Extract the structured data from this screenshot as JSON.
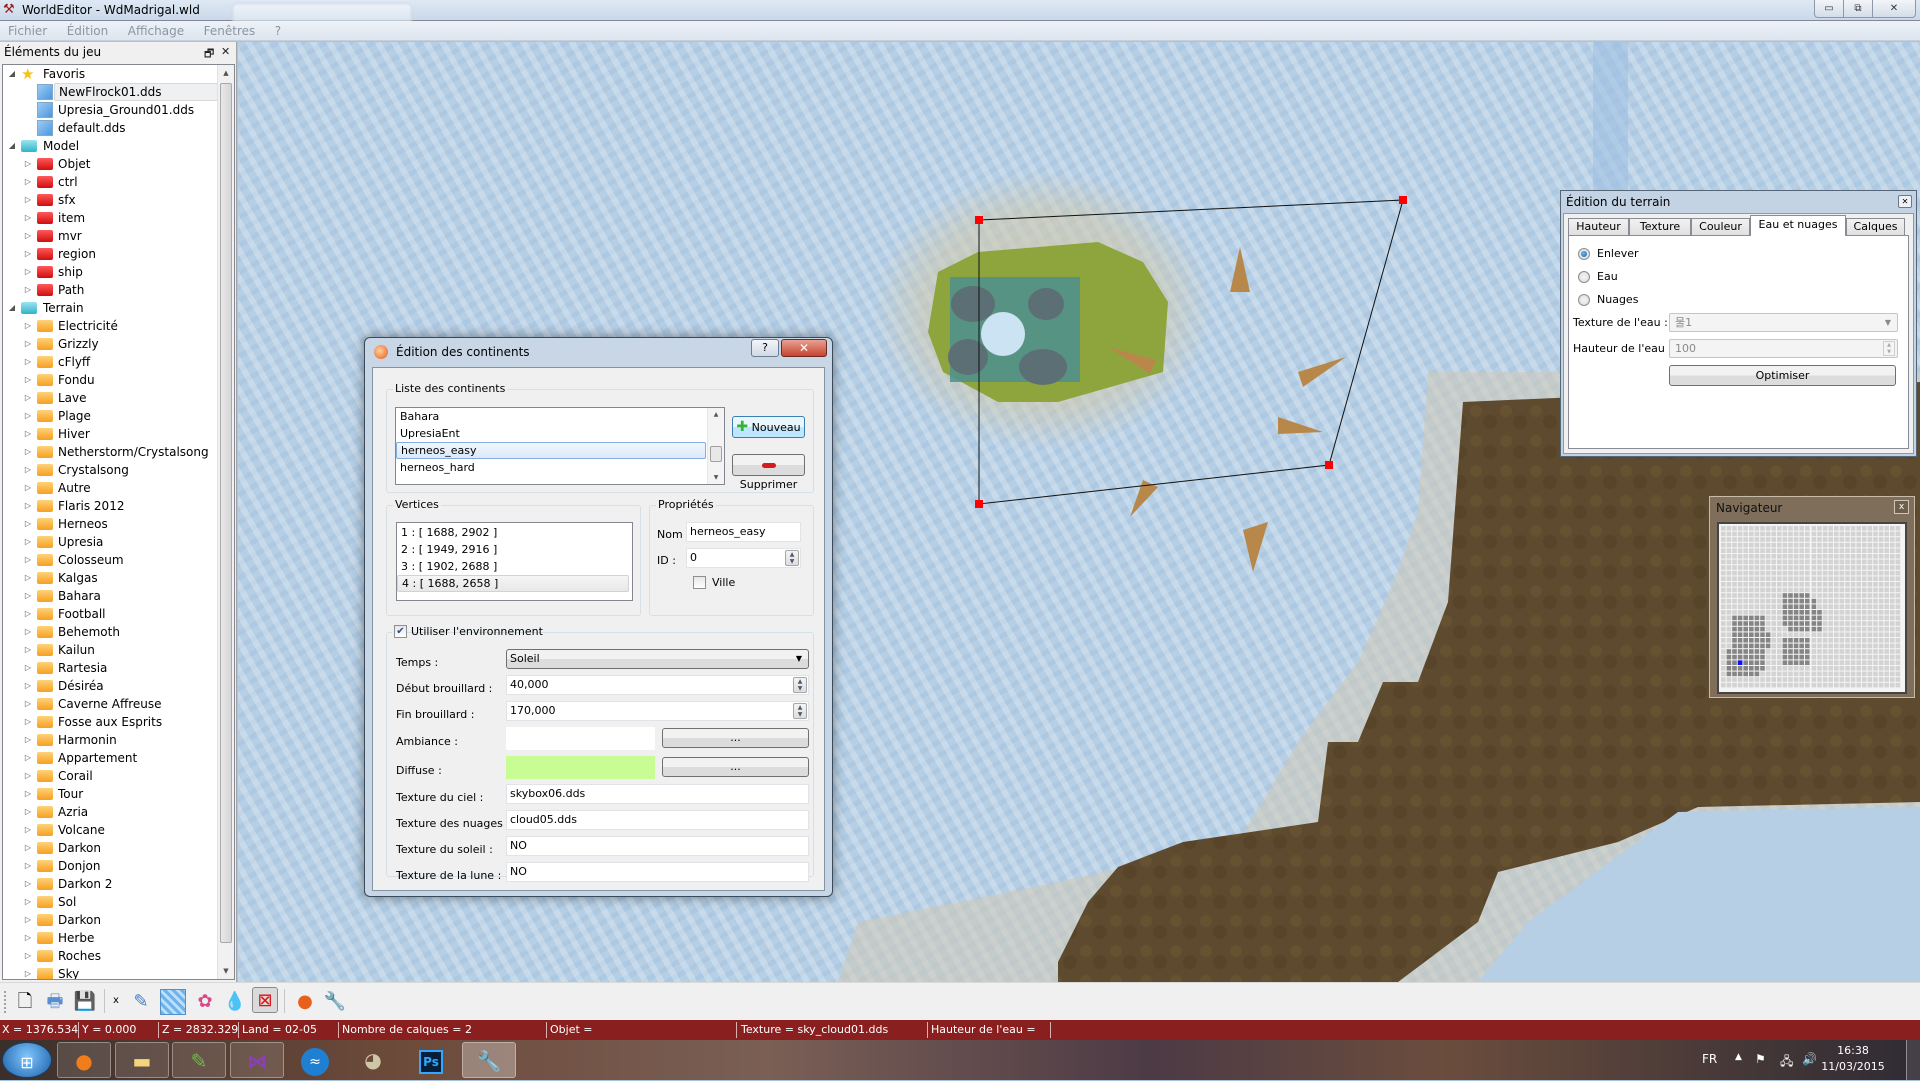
{
  "window": {
    "title": "WorldEditor - WdMadrigal.wld",
    "controls": {
      "minimize": "▭",
      "restore": "⧉",
      "close": "✕"
    }
  },
  "menu": [
    "Fichier",
    "Édition",
    "Affichage",
    "Fenêtres",
    "?"
  ],
  "dock": {
    "title": "Éléments du jeu",
    "float_icon": "🗗",
    "close_icon": "✕",
    "tree": [
      {
        "label": "Favoris",
        "level": 0,
        "icon": "star-icon",
        "expanded": true
      },
      {
        "label": "NewFlrock01.dds",
        "level": 1,
        "icon": "texture-icon",
        "selected": true
      },
      {
        "label": "Upresia_Ground01.dds",
        "level": 1,
        "icon": "texture-icon"
      },
      {
        "label": "default.dds",
        "level": 1,
        "icon": "texture-icon"
      },
      {
        "label": "Model",
        "level": 0,
        "icon": "folder-cyan-icon",
        "expanded": true
      },
      {
        "label": "Objet",
        "level": 1,
        "icon": "folder-red-icon"
      },
      {
        "label": "ctrl",
        "level": 1,
        "icon": "folder-red-icon"
      },
      {
        "label": "sfx",
        "level": 1,
        "icon": "folder-red-icon"
      },
      {
        "label": "item",
        "level": 1,
        "icon": "folder-red-icon"
      },
      {
        "label": "mvr",
        "level": 1,
        "icon": "folder-red-icon"
      },
      {
        "label": "region",
        "level": 1,
        "icon": "folder-red-icon"
      },
      {
        "label": "ship",
        "level": 1,
        "icon": "folder-red-icon"
      },
      {
        "label": "Path",
        "level": 1,
        "icon": "folder-red-icon"
      },
      {
        "label": "Terrain",
        "level": 0,
        "icon": "folder-cyan-icon",
        "expanded": true
      },
      {
        "label": "Electricité",
        "level": 1,
        "icon": "folder-orange-icon"
      },
      {
        "label": "Grizzly",
        "level": 1,
        "icon": "folder-orange-icon"
      },
      {
        "label": "cFlyff",
        "level": 1,
        "icon": "folder-orange-icon"
      },
      {
        "label": "Fondu",
        "level": 1,
        "icon": "folder-orange-icon"
      },
      {
        "label": "Lave",
        "level": 1,
        "icon": "folder-orange-icon"
      },
      {
        "label": "Plage",
        "level": 1,
        "icon": "folder-orange-icon"
      },
      {
        "label": "Hiver",
        "level": 1,
        "icon": "folder-orange-icon"
      },
      {
        "label": "Netherstorm/Crystalsong",
        "level": 1,
        "icon": "folder-orange-icon"
      },
      {
        "label": "Crystalsong",
        "level": 1,
        "icon": "folder-orange-icon"
      },
      {
        "label": "Autre",
        "level": 1,
        "icon": "folder-orange-icon"
      },
      {
        "label": "Flaris 2012",
        "level": 1,
        "icon": "folder-orange-icon"
      },
      {
        "label": "Herneos",
        "level": 1,
        "icon": "folder-orange-icon"
      },
      {
        "label": "Upresia",
        "level": 1,
        "icon": "folder-orange-icon"
      },
      {
        "label": "Colosseum",
        "level": 1,
        "icon": "folder-orange-icon"
      },
      {
        "label": "Kalgas",
        "level": 1,
        "icon": "folder-orange-icon"
      },
      {
        "label": "Bahara",
        "level": 1,
        "icon": "folder-orange-icon"
      },
      {
        "label": "Football",
        "level": 1,
        "icon": "folder-orange-icon"
      },
      {
        "label": "Behemoth",
        "level": 1,
        "icon": "folder-orange-icon"
      },
      {
        "label": "Kailun",
        "level": 1,
        "icon": "folder-orange-icon"
      },
      {
        "label": "Rartesia",
        "level": 1,
        "icon": "folder-orange-icon"
      },
      {
        "label": "Désiréa",
        "level": 1,
        "icon": "folder-orange-icon"
      },
      {
        "label": "Caverne Affreuse",
        "level": 1,
        "icon": "folder-orange-icon"
      },
      {
        "label": "Fosse aux Esprits",
        "level": 1,
        "icon": "folder-orange-icon"
      },
      {
        "label": "Harmonin",
        "level": 1,
        "icon": "folder-orange-icon"
      },
      {
        "label": "Appartement",
        "level": 1,
        "icon": "folder-orange-icon"
      },
      {
        "label": "Corail",
        "level": 1,
        "icon": "folder-orange-icon"
      },
      {
        "label": "Tour",
        "level": 1,
        "icon": "folder-orange-icon"
      },
      {
        "label": "Azria",
        "level": 1,
        "icon": "folder-orange-icon"
      },
      {
        "label": "Volcane",
        "level": 1,
        "icon": "folder-orange-icon"
      },
      {
        "label": "Darkon",
        "level": 1,
        "icon": "folder-orange-icon"
      },
      {
        "label": "Donjon",
        "level": 1,
        "icon": "folder-orange-icon"
      },
      {
        "label": "Darkon 2",
        "level": 1,
        "icon": "folder-orange-icon"
      },
      {
        "label": "Sol",
        "level": 1,
        "icon": "folder-orange-icon"
      },
      {
        "label": "Darkon",
        "level": 1,
        "icon": "folder-orange-icon"
      },
      {
        "label": "Herbe",
        "level": 1,
        "icon": "folder-orange-icon"
      },
      {
        "label": "Roches",
        "level": 1,
        "icon": "folder-orange-icon"
      },
      {
        "label": "Sky",
        "level": 1,
        "icon": "folder-orange-icon"
      }
    ]
  },
  "continents_dialog": {
    "title": "Édition des continents",
    "help": "?",
    "close": "✕",
    "list_group": "Liste des continents",
    "continents": [
      "Bahara",
      "UpresiaEnt",
      "herneos_easy",
      "herneos_hard"
    ],
    "selected_continent": "herneos_easy",
    "new_button": "Nouveau",
    "delete_button": "Supprimer",
    "vertices_group": "Vertices",
    "vertices": [
      "1 : [ 1688, 2902 ]",
      "2 : [ 1949, 2916 ]",
      "3 : [ 1902, 2688 ]",
      "4 : [ 1688, 2658 ]"
    ],
    "properties_group": "Propriétés",
    "name_label": "Nom :",
    "name_value": "herneos_easy",
    "id_label": "ID :",
    "id_value": "0",
    "town_label": "Ville",
    "town_checked": false,
    "env_label": "Utiliser l'environnement",
    "env_checked": true,
    "weather_label": "Temps :",
    "weather_value": "Soleil",
    "fog_start_label": "Début brouillard :",
    "fog_start_value": "40,000",
    "fog_end_label": "Fin brouillard :",
    "fog_end_value": "170,000",
    "ambient_label": "Ambiance :",
    "ambient_color": "#ffffff",
    "diffuse_label": "Diffuse :",
    "diffuse_color": "#c8fd96",
    "pick_button": "...",
    "sky_texture_label": "Texture du ciel :",
    "sky_texture_value": "skybox06.dds",
    "cloud_texture_label": "Texture des nuages :",
    "cloud_texture_value": "cloud05.dds",
    "sun_texture_label": "Texture du soleil :",
    "sun_texture_value": "NO",
    "moon_texture_label": "Texture de la lune :",
    "moon_texture_value": "NO"
  },
  "terrain_panel": {
    "title": "Édition du terrain",
    "tabs": [
      "Hauteur",
      "Texture",
      "Couleur",
      "Eau et nuages",
      "Calques"
    ],
    "active_tab": "Eau et nuages",
    "radios": [
      {
        "label": "Enlever",
        "checked": true
      },
      {
        "label": "Eau",
        "checked": false
      },
      {
        "label": "Nuages",
        "checked": false
      }
    ],
    "water_texture_label": "Texture de l'eau :",
    "water_texture_value": "물1",
    "water_height_label": "Hauteur de l'eau :",
    "water_height_value": "100",
    "optimize_button": "Optimiser"
  },
  "navigator": {
    "title": "Navigateur",
    "close": "x"
  },
  "toolbar": {
    "x_label": "x",
    "tools": [
      "new-file-icon",
      "print-icon",
      "save-icon",
      "terrain-height-icon",
      "terrain-texture-icon",
      "terrain-color-icon",
      "water-icon",
      "continent-edit-icon",
      "environment-icon",
      "settings-wrench-icon"
    ],
    "active_tool": "continent-edit-icon"
  },
  "statusbar": {
    "x": "X = 1376.534",
    "y": "Y = 0.000",
    "z": "Z = 2832.329",
    "land": "Land = 02-05",
    "layers": "Nombre de calques = 2",
    "object": "Objet =",
    "texture": "Texture = sky_cloud01.dds",
    "water_height": "Hauteur de l'eau ="
  },
  "taskbar": {
    "apps": [
      "start-button",
      "firefox",
      "file-explorer",
      "notepad-plus-plus",
      "visual-studio",
      "openoffice",
      "gimp",
      "photoshop",
      "worldeditor"
    ],
    "language": "FR",
    "time": "16:38",
    "date": "11/03/2015"
  }
}
